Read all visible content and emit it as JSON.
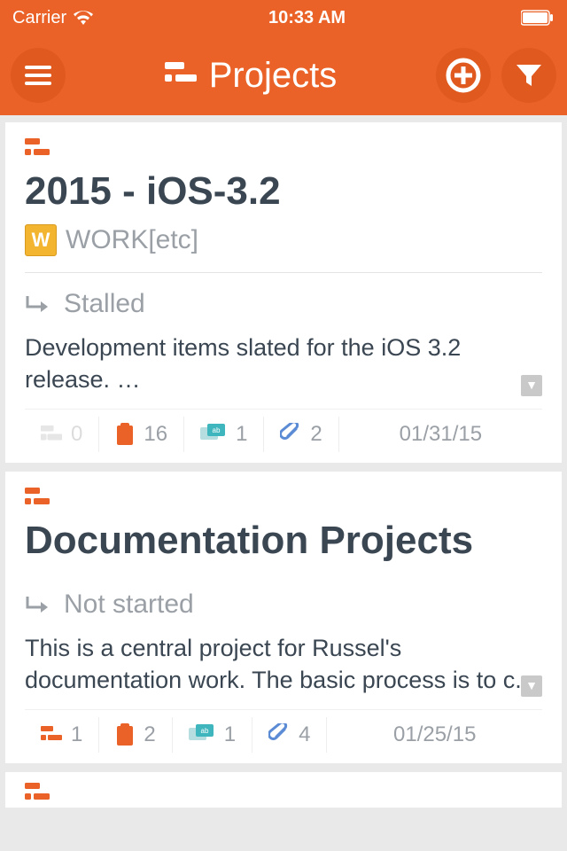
{
  "status_bar": {
    "carrier": "Carrier",
    "time": "10:33 AM"
  },
  "header": {
    "title": "Projects"
  },
  "projects": [
    {
      "title": "2015 - iOS-3.2",
      "org": "WORK[etc]",
      "status": "Stalled",
      "description": "Development items slated for the iOS 3.2 release. …",
      "counts": {
        "subprojects": "0",
        "tasks": "16",
        "discussions": "1",
        "attachments": "2"
      },
      "date": "01/31/15",
      "subprojects_muted": true
    },
    {
      "title": "Documentation Projects",
      "org": "",
      "status": "Not started",
      "description": "This is a central project for Russel's documentation work.  The basic process is to c..",
      "counts": {
        "subprojects": "1",
        "tasks": "2",
        "discussions": "1",
        "attachments": "4"
      },
      "date": "01/25/15",
      "subprojects_muted": false
    }
  ]
}
